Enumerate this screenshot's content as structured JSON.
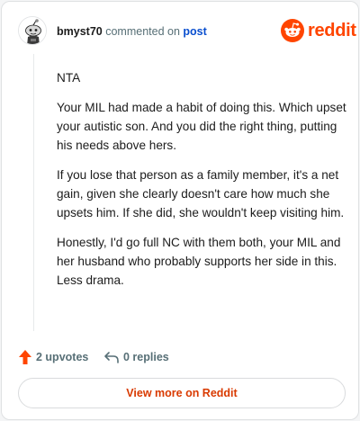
{
  "comment": {
    "username": "bmyst70",
    "action_text": "commented on",
    "target_link": "post",
    "paragraphs": [
      "NTA",
      "Your MIL had made a habit of doing this. Which upset your autistic son. And you did the right thing, putting his needs above hers.",
      "If you lose that person as a family member, it's a net gain, given she clearly doesn't care how much she upsets him. If she did, she wouldn't keep visiting him.",
      "Honestly, I'd go full NC with them both, your MIL and her husband who probably supports her side in this. Less drama."
    ]
  },
  "brand": {
    "wordmark": "reddit",
    "icon": "reddit-logo-icon",
    "color": "#ff4500"
  },
  "actions": {
    "upvotes_label": "2 upvotes",
    "upvote_icon": "upvote-arrow-icon",
    "upvote_color": "#ff4500",
    "replies_label": "0 replies",
    "reply_icon": "reply-arrow-icon"
  },
  "footer": {
    "view_more_label": "View more on Reddit",
    "color": "#d93a00"
  }
}
